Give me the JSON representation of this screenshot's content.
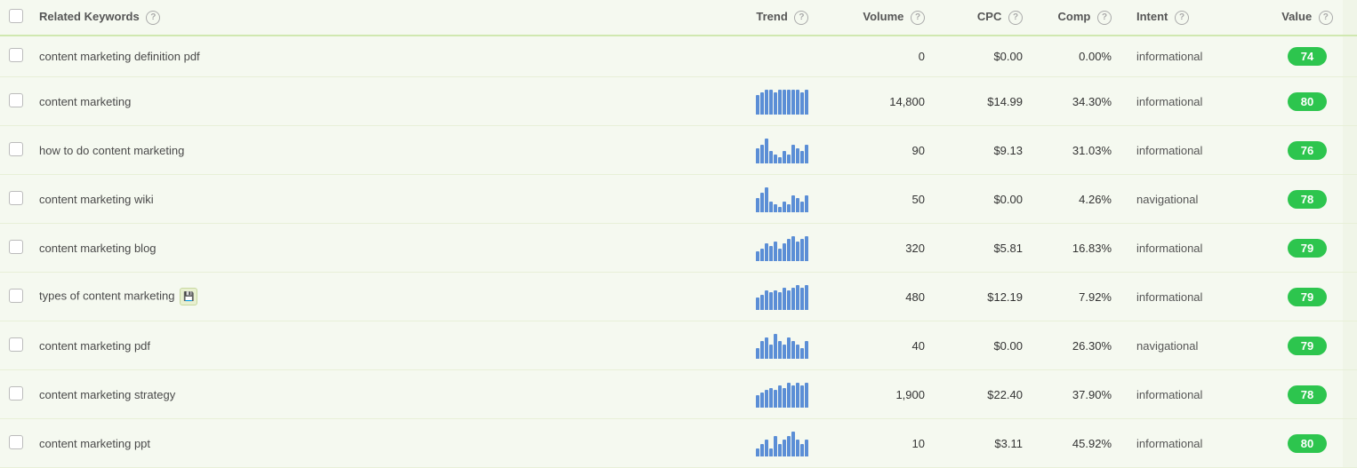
{
  "table": {
    "columns": {
      "checkbox": "",
      "keyword": "Related Keywords",
      "trend": "Trend",
      "volume": "Volume",
      "cpc": "CPC",
      "comp": "Comp",
      "intent": "Intent",
      "value": "Value"
    },
    "rows": [
      {
        "keyword": "content marketing definition pdf",
        "trend": [],
        "volume": "0",
        "cpc": "$0.00",
        "comp": "0.00%",
        "intent": "informational",
        "value": "74",
        "has_tag": false
      },
      {
        "keyword": "content marketing",
        "trend": [
          8,
          9,
          10,
          10,
          9,
          10,
          10,
          10,
          10,
          10,
          9,
          10
        ],
        "volume": "14,800",
        "cpc": "$14.99",
        "comp": "34.30%",
        "intent": "informational",
        "value": "80",
        "has_tag": false
      },
      {
        "keyword": "how to do content marketing",
        "trend": [
          5,
          6,
          8,
          4,
          3,
          2,
          4,
          3,
          6,
          5,
          4,
          6
        ],
        "volume": "90",
        "cpc": "$9.13",
        "comp": "31.03%",
        "intent": "informational",
        "value": "76",
        "has_tag": false
      },
      {
        "keyword": "content marketing wiki",
        "trend": [
          5,
          7,
          9,
          4,
          3,
          2,
          4,
          3,
          6,
          5,
          4,
          6
        ],
        "volume": "50",
        "cpc": "$0.00",
        "comp": "4.26%",
        "intent": "navigational",
        "value": "78",
        "has_tag": false
      },
      {
        "keyword": "content marketing blog",
        "trend": [
          4,
          5,
          7,
          6,
          8,
          5,
          7,
          9,
          10,
          8,
          9,
          10
        ],
        "volume": "320",
        "cpc": "$5.81",
        "comp": "16.83%",
        "intent": "informational",
        "value": "79",
        "has_tag": false
      },
      {
        "keyword": "types of content marketing",
        "trend": [
          5,
          6,
          8,
          7,
          8,
          7,
          9,
          8,
          9,
          10,
          9,
          10
        ],
        "volume": "480",
        "cpc": "$12.19",
        "comp": "7.92%",
        "intent": "informational",
        "value": "79",
        "has_tag": true
      },
      {
        "keyword": "content marketing pdf",
        "trend": [
          3,
          5,
          6,
          4,
          7,
          5,
          4,
          6,
          5,
          4,
          3,
          5
        ],
        "volume": "40",
        "cpc": "$0.00",
        "comp": "26.30%",
        "intent": "navigational",
        "value": "79",
        "has_tag": false
      },
      {
        "keyword": "content marketing strategy",
        "trend": [
          5,
          6,
          7,
          8,
          7,
          9,
          8,
          10,
          9,
          10,
          9,
          10
        ],
        "volume": "1,900",
        "cpc": "$22.40",
        "comp": "37.90%",
        "intent": "informational",
        "value": "78",
        "has_tag": false
      },
      {
        "keyword": "content marketing ppt",
        "trend": [
          2,
          3,
          4,
          2,
          5,
          3,
          4,
          5,
          6,
          4,
          3,
          4
        ],
        "volume": "10",
        "cpc": "$3.11",
        "comp": "45.92%",
        "intent": "informational",
        "value": "80",
        "has_tag": false
      }
    ]
  }
}
